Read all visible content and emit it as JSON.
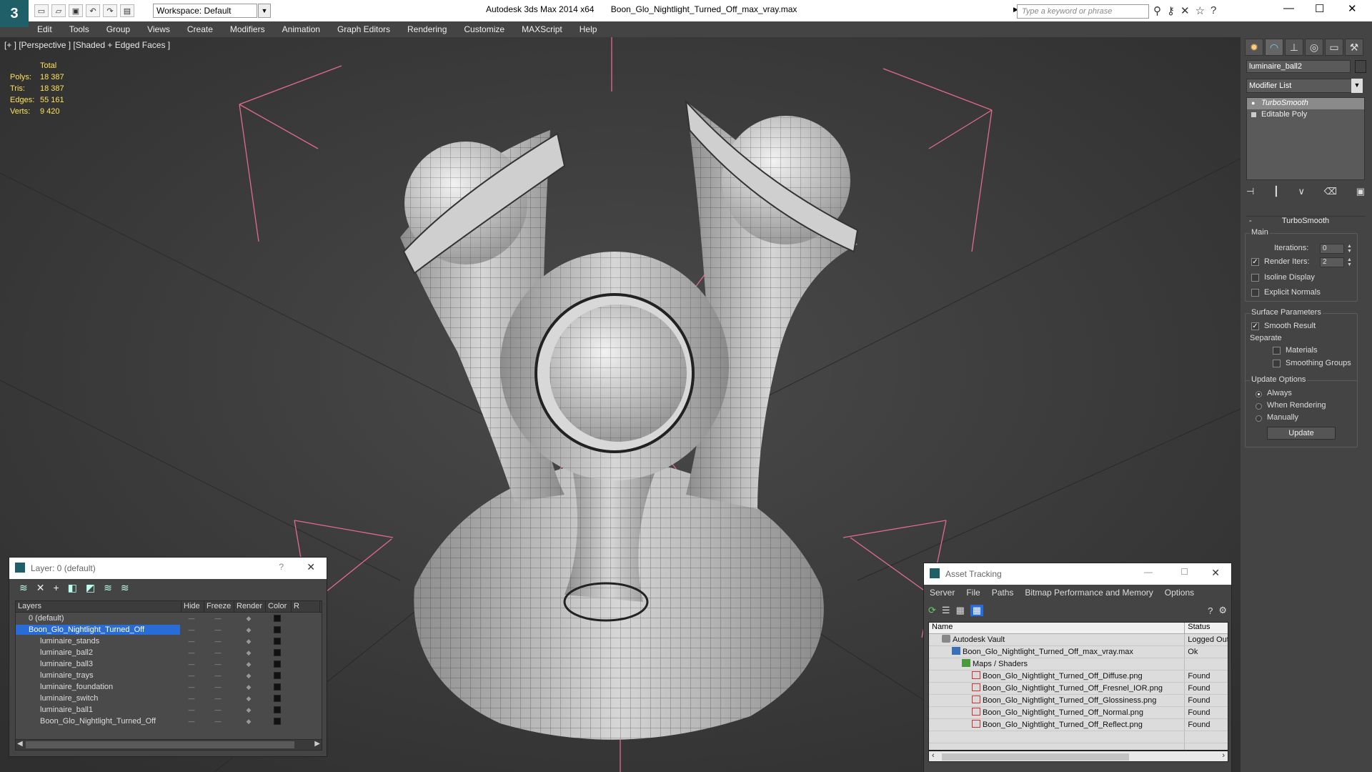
{
  "app": {
    "workspace": "Workspace: Default",
    "product": "Autodesk 3ds Max  2014 x64",
    "filename": "Boon_Glo_Nightlight_Turned_Off_max_vray.max",
    "search_placeholder": "Type a keyword or phrase",
    "min_label": "—",
    "max_label": "☐",
    "close_label": "✕"
  },
  "menu": [
    "Edit",
    "Tools",
    "Group",
    "Views",
    "Create",
    "Modifiers",
    "Animation",
    "Graph Editors",
    "Rendering",
    "Customize",
    "MAXScript",
    "Help"
  ],
  "viewport": {
    "label": "[+ ] [Perspective ] [Shaded + Edged Faces ]",
    "stats": {
      "header": "Total",
      "rows": [
        {
          "k": "Polys:",
          "v": "18 387"
        },
        {
          "k": "Tris:",
          "v": "18 387"
        },
        {
          "k": "Edges:",
          "v": "55 161"
        },
        {
          "k": "Verts:",
          "v": "9 420"
        }
      ]
    }
  },
  "command_panel": {
    "object_name": "luminaire_ball2",
    "modifier_list": "Modifier List",
    "stack": [
      "TurboSmooth",
      "Editable Poly"
    ],
    "rollout_title": "TurboSmooth",
    "main_group": "Main",
    "iterations_label": "Iterations:",
    "iterations_value": "0",
    "render_iters_label": "Render Iters:",
    "render_iters_value": "2",
    "isoline_label": "Isoline Display",
    "explicit_normals_label": "Explicit Normals",
    "surface_group": "Surface Parameters",
    "smooth_result_label": "Smooth Result",
    "separate_label": "Separate",
    "materials_label": "Materials",
    "smoothing_groups_label": "Smoothing Groups",
    "update_group": "Update Options",
    "always_label": "Always",
    "when_rendering_label": "When Rendering",
    "manually_label": "Manually",
    "update_button": "Update"
  },
  "layer_dialog": {
    "title": "Layer: 0 (default)",
    "help": "?",
    "close": "✕",
    "columns": [
      "Layers",
      "Hide",
      "Freeze",
      "Render",
      "Color",
      "R"
    ],
    "layers": [
      {
        "name": "0 (default)",
        "indent": 1,
        "active": true
      },
      {
        "name": "Boon_Glo_Nightlight_Turned_Off",
        "indent": 1,
        "selected": true
      },
      {
        "name": "luminaire_stands",
        "indent": 2
      },
      {
        "name": "luminaire_ball2",
        "indent": 2
      },
      {
        "name": "luminaire_ball3",
        "indent": 2
      },
      {
        "name": "luminaire_trays",
        "indent": 2
      },
      {
        "name": "luminaire_foundation",
        "indent": 2
      },
      {
        "name": "luminaire_switch",
        "indent": 2
      },
      {
        "name": "luminaire_ball1",
        "indent": 2
      },
      {
        "name": "Boon_Glo_Nightlight_Turned_Off",
        "indent": 2
      }
    ]
  },
  "asset_dialog": {
    "title": "Asset Tracking",
    "menu": [
      "Server",
      "File",
      "Paths",
      "Bitmap Performance and Memory",
      "Options"
    ],
    "col_name": "Name",
    "col_status": "Status",
    "rows": [
      {
        "name": "Autodesk Vault",
        "status": "Logged Out",
        "icon": "vault",
        "indent": 1
      },
      {
        "name": "Boon_Glo_Nightlight_Turned_Off_max_vray.max",
        "status": "Ok",
        "icon": "file",
        "indent": 2
      },
      {
        "name": "Maps / Shaders",
        "status": "",
        "icon": "folder",
        "indent": 3
      },
      {
        "name": "Boon_Glo_Nightlight_Turned_Off_Diffuse.png",
        "status": "Found",
        "icon": "png",
        "indent": 4
      },
      {
        "name": "Boon_Glo_Nightlight_Turned_Off_Fresnel_IOR.png",
        "status": "Found",
        "icon": "png",
        "indent": 4
      },
      {
        "name": "Boon_Glo_Nightlight_Turned_Off_Glossiness.png",
        "status": "Found",
        "icon": "png",
        "indent": 4
      },
      {
        "name": "Boon_Glo_Nightlight_Turned_Off_Normal.png",
        "status": "Found",
        "icon": "png",
        "indent": 4
      },
      {
        "name": "Boon_Glo_Nightlight_Turned_Off_Reflect.png",
        "status": "Found",
        "icon": "png",
        "indent": 4
      }
    ]
  }
}
